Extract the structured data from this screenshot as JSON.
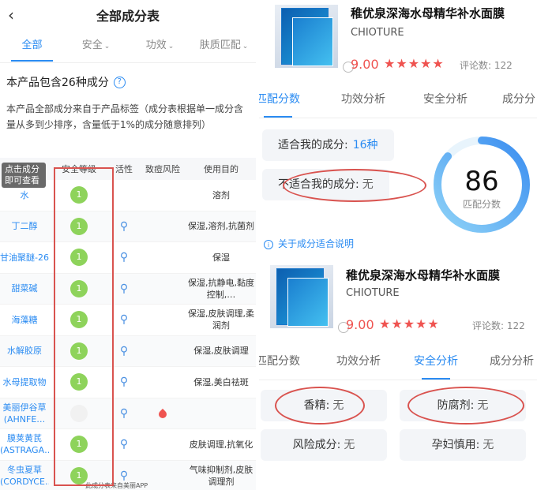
{
  "left": {
    "header": {
      "title": "全部成分表"
    },
    "tabs": [
      {
        "label": "全部",
        "active": true
      },
      {
        "label": "安全",
        "caret": "⌄"
      },
      {
        "label": "功效",
        "caret": "⌄"
      },
      {
        "label": "肤质匹配",
        "caret": "⌄"
      }
    ],
    "count_text": "本产品包含26种成分",
    "description": "本产品全部成分来自于产品标签（成分表根据单一成分含量从多到少排序，含量低于1%的成分随意排列）",
    "table_headers": [
      "成分",
      "安全等级",
      "活性",
      "致痘风险",
      "使用目的"
    ],
    "tooltip": "点击成分即可查看",
    "rows": [
      {
        "name": "水",
        "safety": "1",
        "active": false,
        "acne": false,
        "use": "溶剂"
      },
      {
        "name": "丁二醇",
        "safety": "1",
        "active": true,
        "acne": false,
        "use": "保湿,溶剂,抗菌剂"
      },
      {
        "name": "甘油聚醚-26",
        "safety": "1",
        "active": true,
        "acne": false,
        "use": "保湿"
      },
      {
        "name": "甜菜碱",
        "safety": "1",
        "active": true,
        "acne": false,
        "use": "保湿,抗静电,黏度控制,…"
      },
      {
        "name": "海藻糖",
        "safety": "1",
        "active": true,
        "acne": false,
        "use": "保湿,皮肤调理,柔润剂"
      },
      {
        "name": "水解胶原",
        "safety": "1",
        "active": true,
        "acne": false,
        "use": "保湿,皮肤调理"
      },
      {
        "name": "水母提取物",
        "safety": "1",
        "active": true,
        "acne": false,
        "use": "保湿,美白祛斑"
      },
      {
        "name": "美丽伊谷草(AHNFE…",
        "safety": "",
        "active": true,
        "acne": true,
        "use": ""
      },
      {
        "name": "膜荚黄芪(ASTRAGA…",
        "safety": "1",
        "active": true,
        "acne": false,
        "use": "皮肤调理,抗氧化"
      },
      {
        "name": "冬虫夏草(CORDYCE…",
        "safety": "1",
        "active": true,
        "acne": false,
        "use": "气味抑制剂,皮肤调理剂"
      }
    ],
    "footer": "此成分表来自美丽APP"
  },
  "right": {
    "product": {
      "title": "稚优泉深海水母精华补水面膜",
      "brand": "CHIOTURE",
      "score": "9.00",
      "stars": "★★★★★",
      "rating_stars": 4.5,
      "reviews_label": "评论数: 122"
    },
    "tabs1": [
      "匹配分数",
      "功效分析",
      "安全分析",
      "成分分"
    ],
    "match": {
      "suitable_label": "适合我的成分:",
      "suitable_value": "16种",
      "unsuitable_label": "不适合我的成分:",
      "unsuitable_value": "无",
      "info_icon": "i",
      "info_text": "关于成分适合说明",
      "score": "86",
      "score_label": "匹配分数"
    },
    "product2": {
      "title": "稚优泉深海水母精华补水面膜",
      "brand": "CHIOTURE",
      "score": "9.00",
      "stars": "★★★★★",
      "rating_stars": 4.5,
      "reviews_label": "评论数: 122"
    },
    "tabs2": [
      "匹配分数",
      "功效分析",
      "安全分析",
      "成分分析"
    ],
    "safety": {
      "fragrance_label": "香精:",
      "fragrance_value": "无",
      "preservative_label": "防腐剂:",
      "preservative_value": "无",
      "risk_label": "风险成分:",
      "risk_value": "无",
      "pregnancy_label": "孕妇慎用:",
      "pregnancy_value": "无"
    }
  },
  "colors": {
    "accent": "#2a8bf2",
    "safe_badge": "#8ed35b",
    "alert": "#ef5350",
    "annotation": "#d9534f"
  }
}
